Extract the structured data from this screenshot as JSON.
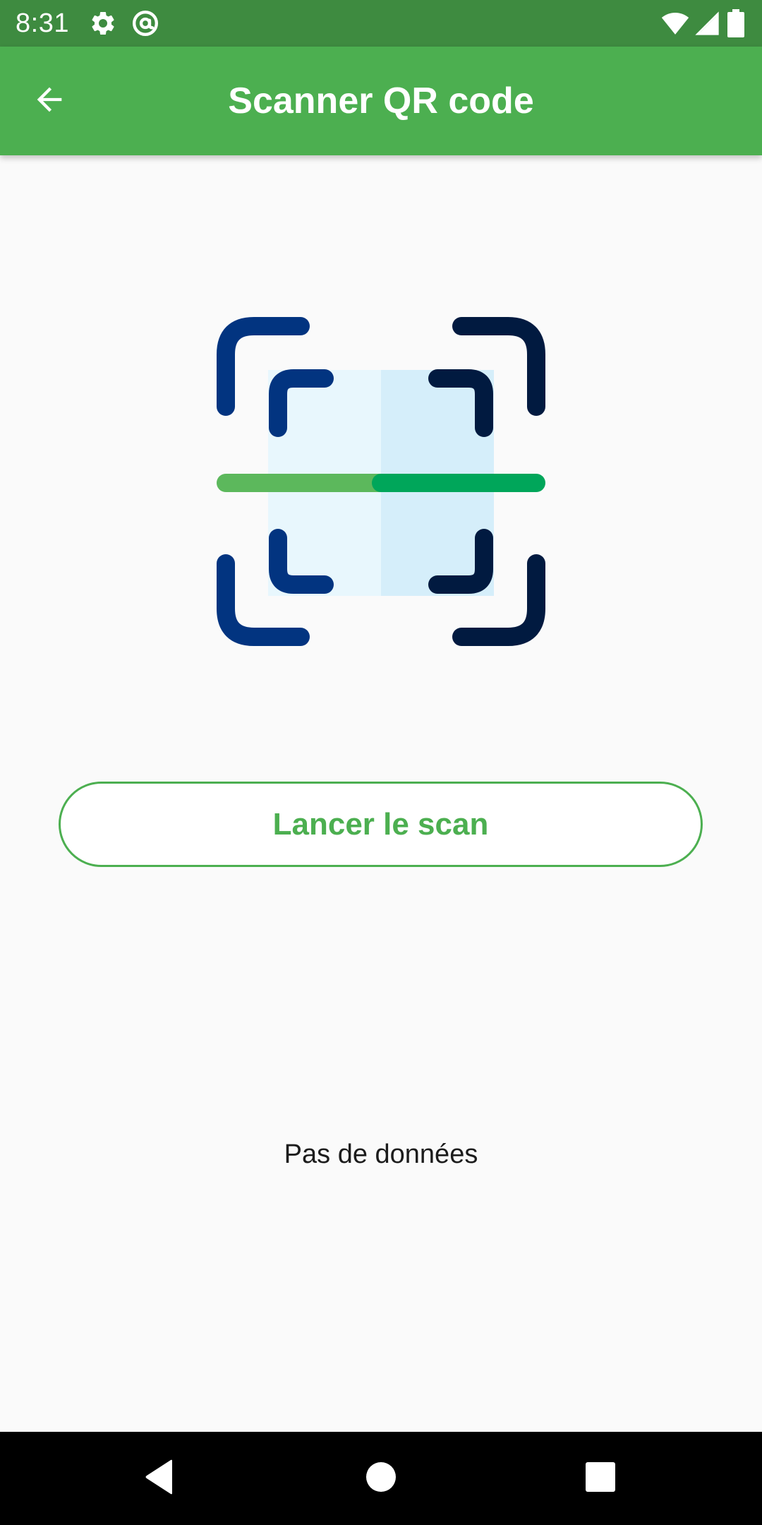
{
  "status_bar": {
    "time": "8:31",
    "icons": [
      "settings-icon",
      "at-sign-icon",
      "wifi-icon",
      "cellular-signal-icon",
      "battery-icon"
    ]
  },
  "app_bar": {
    "title": "Scanner QR code",
    "back_icon": "arrow-back-icon",
    "background_color": "#4caf50"
  },
  "illustration": {
    "icon": "qr-scan-illustration-icon",
    "colors": {
      "frame_dark_blue": "#023480",
      "frame_navy": "#011a40",
      "scan_line_green": "#5cb85c",
      "scan_line_dark_green": "#00a65a",
      "panel_light": "#e8f7fd",
      "panel_blue": "#d5eefa"
    }
  },
  "scan_button": {
    "label": "Lancer le scan",
    "accent_color": "#4caf50"
  },
  "result": {
    "empty_message": "Pas de données"
  },
  "nav_bar": {
    "buttons": [
      "back-triangle-icon",
      "home-circle-icon",
      "recents-square-icon"
    ]
  }
}
